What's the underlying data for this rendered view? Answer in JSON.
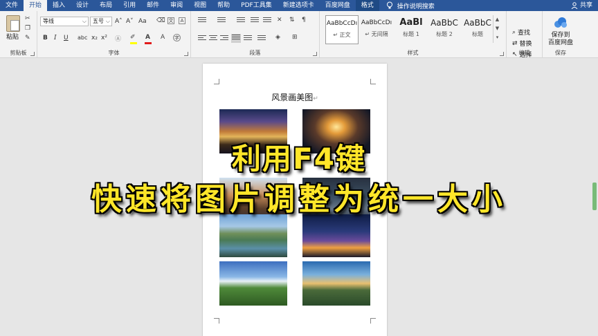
{
  "menu": {
    "tabs": [
      "文件",
      "开始",
      "插入",
      "设计",
      "布局",
      "引用",
      "邮件",
      "审阅",
      "视图",
      "帮助",
      "PDF工具集",
      "新建选项卡",
      "百度网盘",
      "格式"
    ],
    "active_tab": "开始",
    "search_label": "操作说明搜索",
    "share_label": "共享"
  },
  "ribbon": {
    "clipboard": {
      "label": "剪贴板",
      "paste": "粘贴"
    },
    "font": {
      "label": "字体",
      "font_name": "等线",
      "font_size": "五号",
      "grow": "A˄",
      "shrink": "A˅",
      "case": "Aa",
      "bold": "B",
      "italic": "I",
      "underline": "U",
      "strike": "abc",
      "subscript": "x₂",
      "superscript": "x²"
    },
    "paragraph": {
      "label": "段落"
    },
    "styles": {
      "label": "样式",
      "items": [
        {
          "sample": "AaBbCcDı",
          "name": "↵ 正文"
        },
        {
          "sample": "AaBbCcDı",
          "name": "↵ 无间隔"
        },
        {
          "sample": "AaBl",
          "name": "标题 1"
        },
        {
          "sample": "AaBbC",
          "name": "标题 2"
        },
        {
          "sample": "AaBbC",
          "name": "标题"
        }
      ]
    },
    "editing": {
      "label": "编辑",
      "find": "查找",
      "replace": "替换",
      "select": "选择"
    },
    "save": {
      "label": "保存",
      "button": "保存到\n百度网盘"
    }
  },
  "document": {
    "title": "风景画美图",
    "para_mark": "↵"
  },
  "caption": {
    "line1": "利用F4键",
    "line2": "快速将图片调整为统一大小"
  }
}
